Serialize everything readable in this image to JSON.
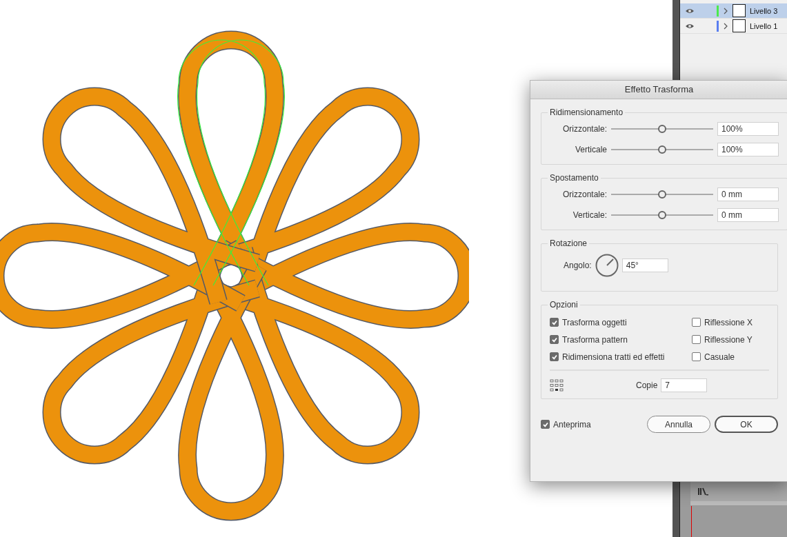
{
  "layers": [
    {
      "name": "Livello 3",
      "color": "#4cea4c",
      "selected": true,
      "visible": true
    },
    {
      "name": "Livello 1",
      "color": "#5a7ef0",
      "selected": false,
      "visible": true
    }
  ],
  "dialog": {
    "title": "Effetto Trasforma",
    "scale": {
      "title": "Ridimensionamento",
      "rows": [
        {
          "label": "Orizzontale:",
          "level": 0.5,
          "value": "100%"
        },
        {
          "label": "Verticale",
          "level": 0.5,
          "value": "100%"
        }
      ]
    },
    "move": {
      "title": "Spostamento",
      "rows": [
        {
          "label": "Orizzontale:",
          "level": 0.5,
          "value": "0 mm"
        },
        {
          "label": "Verticale:",
          "level": 0.5,
          "value": "0 mm"
        }
      ]
    },
    "rotation": {
      "title": "Rotazione",
      "label": "Angolo:",
      "value": "45°"
    },
    "options": {
      "title": "Opzioni",
      "left": [
        {
          "label": "Trasforma oggetti",
          "checked": true
        },
        {
          "label": "Trasforma pattern",
          "checked": true
        },
        {
          "label": "Ridimensiona tratti ed effetti",
          "checked": true
        }
      ],
      "right": [
        {
          "label": "Riflessione X",
          "checked": false
        },
        {
          "label": "Riflessione Y",
          "checked": false
        },
        {
          "label": "Casuale",
          "checked": false
        }
      ],
      "copies_label": "Copie",
      "copies_value": "7"
    },
    "preview": {
      "label": "Anteprima",
      "checked": true
    },
    "buttons": [
      {
        "label": "Annulla",
        "kind": "cancel"
      },
      {
        "label": "OK",
        "kind": "default"
      }
    ]
  }
}
